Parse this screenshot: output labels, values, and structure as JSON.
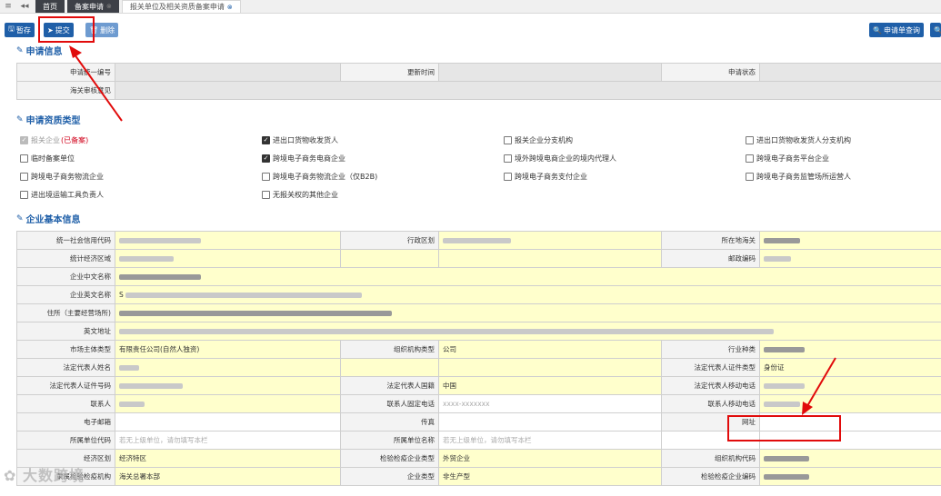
{
  "tabs": {
    "home": "首页",
    "filing": "备案申请",
    "active": "报关单位及相关资质备案申请"
  },
  "toolbar": {
    "save": "暂存",
    "submit": "提交",
    "delete": "删除",
    "query": "申请单查询"
  },
  "sections": {
    "apply_info": "申请信息",
    "qualification": "申请资质类型",
    "company": "企业基本信息"
  },
  "apply_info": {
    "unified_no_label": "申请统一编号",
    "update_time_label": "更新时间",
    "status_label": "申请状态",
    "customs_opinion_label": "海关审核意见"
  },
  "qualifications": {
    "q1": "报关企业",
    "q1_note": "(已备案)",
    "q2": "进出口货物收发货人",
    "q3": "报关企业分支机构",
    "q4": "进出口货物收发货人分支机构",
    "q5": "临时备案单位",
    "q6": "跨境电子商务电商企业",
    "q7": "境外跨境电商企业的境内代理人",
    "q8": "跨境电子商务平台企业",
    "q9": "跨境电子商务物流企业",
    "q10": "跨境电子商务物流企业（仅B2B)",
    "q11": "跨境电子商务支付企业",
    "q12": "跨境电子商务监管场所运营人",
    "q13": "进出境运输工具负责人",
    "q14": "无报关权的其他企业"
  },
  "company": {
    "credit_code_label": "统一社会信用代码",
    "region_label": "行政区划",
    "customs_label": "所在地海关",
    "econ_zone_label": "统计经济区域",
    "postcode_label": "邮政编码",
    "cn_name_label": "企业中文名称",
    "en_name_label": "企业英文名称",
    "en_name_prefix": "S",
    "address_label": "住所（主要经营场所)",
    "en_address_label": "英文地址",
    "entity_type_label": "市场主体类型",
    "entity_type_value": "有限责任公司(自然人独资)",
    "org_type_label": "组织机构类型",
    "org_type_value": "公司",
    "industry_label": "行业种类",
    "legal_name_label": "法定代表人姓名",
    "legal_id_type_label": "法定代表人证件类型",
    "legal_id_type_value": "身份证",
    "legal_id_no_label": "法定代表人证件号码",
    "legal_nationality_label": "法定代表人国籍",
    "legal_nationality_value": "中国",
    "legal_mobile_label": "法定代表人移动电话",
    "contact_label": "联系人",
    "contact_phone_label": "联系人固定电话",
    "contact_phone_placeholder": "xxxx-xxxxxxx",
    "contact_mobile_label": "联系人移动电话",
    "email_label": "电子邮箱",
    "fax_label": "传真",
    "website_label": "网址",
    "parent_code_label": "所属单位代码",
    "parent_code_placeholder": "若无上级单位，请勿填写本栏",
    "parent_name_label": "所属单位名称",
    "parent_name_placeholder": "若无上级单位，请勿填写本栏",
    "econ_region_label": "经济区划",
    "econ_region_value": "经济特区",
    "insp_type_label": "检验检疫企业类型",
    "insp_type_value": "外贸企业",
    "org_code_label": "组织机构代码",
    "insp_office_label": "隶属检验检疫机构",
    "insp_office_value": "海关总署本部",
    "ent_type_label": "企业类型",
    "ent_type_value": "非生产型",
    "insp_code_label": "检验检疫企业编码"
  },
  "watermark": "大数跨境"
}
